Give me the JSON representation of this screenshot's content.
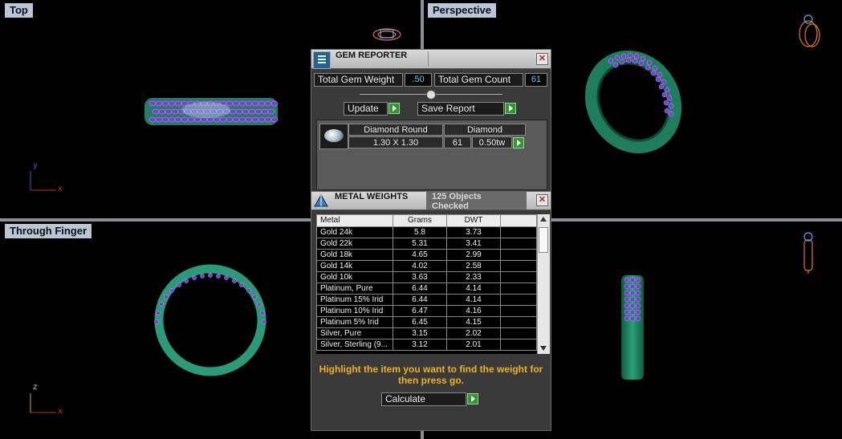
{
  "viewports": {
    "top": {
      "label": "Top",
      "axis_v": "y",
      "axis_h": "x"
    },
    "perspective": {
      "label": "Perspective"
    },
    "through_finger": {
      "label": "Through Finger",
      "axis_v": "z",
      "axis_h": "x"
    }
  },
  "gem_reporter": {
    "title": "GEM REPORTER",
    "total_weight_label": "Total Gem Weight",
    "total_weight_value": ".50",
    "total_count_label": "Total Gem Count",
    "total_count_value": "61",
    "update_label": "Update",
    "save_report_label": "Save Report",
    "gem": {
      "shape": "Diamond Round",
      "size": "1.30 X 1.30",
      "type": "Diamond",
      "count": "61",
      "weight": "0.50tw"
    }
  },
  "metal_weights": {
    "title": "METAL WEIGHTS",
    "objects_checked": "125 Objects Checked",
    "columns": [
      "Metal",
      "Grams",
      "DWT",
      ""
    ],
    "rows": [
      [
        "Gold 24k",
        "5.8",
        "3.73"
      ],
      [
        "Gold 22k",
        "5.31",
        "3.41"
      ],
      [
        "Gold 18k",
        "4.65",
        "2.99"
      ],
      [
        "Gold 14k",
        "4.02",
        "2.58"
      ],
      [
        "Gold 10k",
        "3.63",
        "2.33"
      ],
      [
        "Platinum, Pure",
        "6.44",
        "4.14"
      ],
      [
        "Platinum 15% Irid",
        "6.44",
        "4.14"
      ],
      [
        "Platinum 10% Irid",
        "6.47",
        "4.16"
      ],
      [
        "Platinum 5% Irid",
        "6.45",
        "4.15"
      ],
      [
        "Silver, Pure",
        "3.15",
        "2.02"
      ],
      [
        "Silver, Sterling (9...",
        "3.12",
        "2.01"
      ]
    ],
    "hint": "Highlight the item you want to find the weight for then press go.",
    "calculate_label": "Calculate"
  },
  "colors": {
    "band_green": "#1e7d5c",
    "gem_purple": "#7a3fd0",
    "hint_yellow": "#f0b020",
    "value_cyan": "#5fc8e8"
  }
}
